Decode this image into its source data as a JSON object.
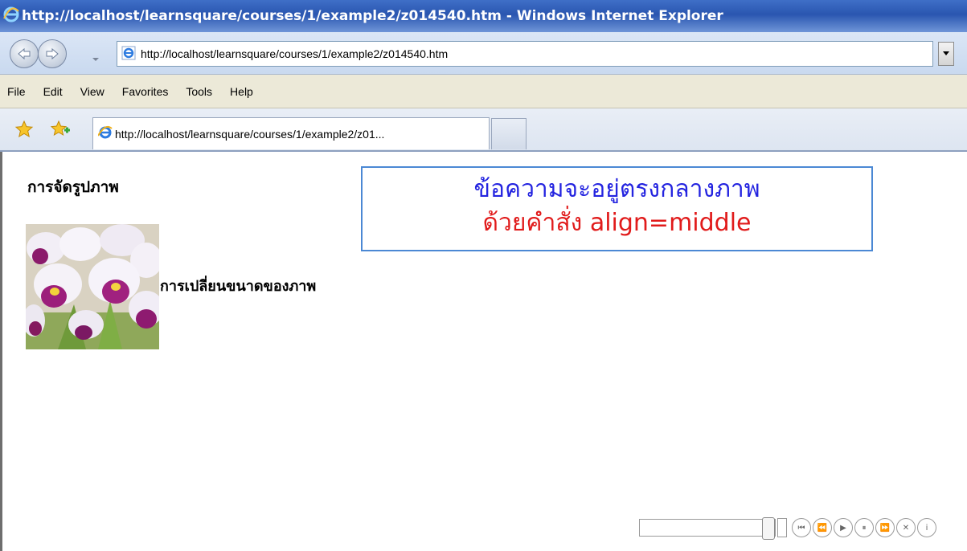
{
  "window": {
    "title": "http://localhost/learnsquare/courses/1/example2/z014540.htm - Windows Internet Explorer"
  },
  "address_bar": {
    "url": "http://localhost/learnsquare/courses/1/example2/z014540.htm"
  },
  "menu": {
    "items": [
      "File",
      "Edit",
      "View",
      "Favorites",
      "Tools",
      "Help"
    ]
  },
  "tabs": {
    "active_label": "http://localhost/learnsquare/courses/1/example2/z01..."
  },
  "page": {
    "heading": "การจัดรูปภาพ",
    "caption": "การเปลี่ยนขนาดของภาพ",
    "note_line1": "ข้อความจะอยู่ตรงกลางภาพ",
    "note_line2": "ด้วยคำสั่ง align=middle"
  },
  "media_player": {
    "progress": 1.0
  },
  "colors": {
    "note_line1": "#2424e0",
    "note_line2": "#e11b1b",
    "note_border": "#4b88d4"
  },
  "icons": {
    "back": "back-arrow-icon",
    "forward": "forward-arrow-icon",
    "favorites": "favorites-star-icon",
    "add_favorite": "add-to-favorites-icon",
    "page": "ie-page-icon",
    "media_controls": [
      "previous-icon",
      "rewind-icon",
      "play-icon",
      "pause-icon",
      "fast-forward-icon",
      "stop-icon",
      "info-icon"
    ]
  }
}
